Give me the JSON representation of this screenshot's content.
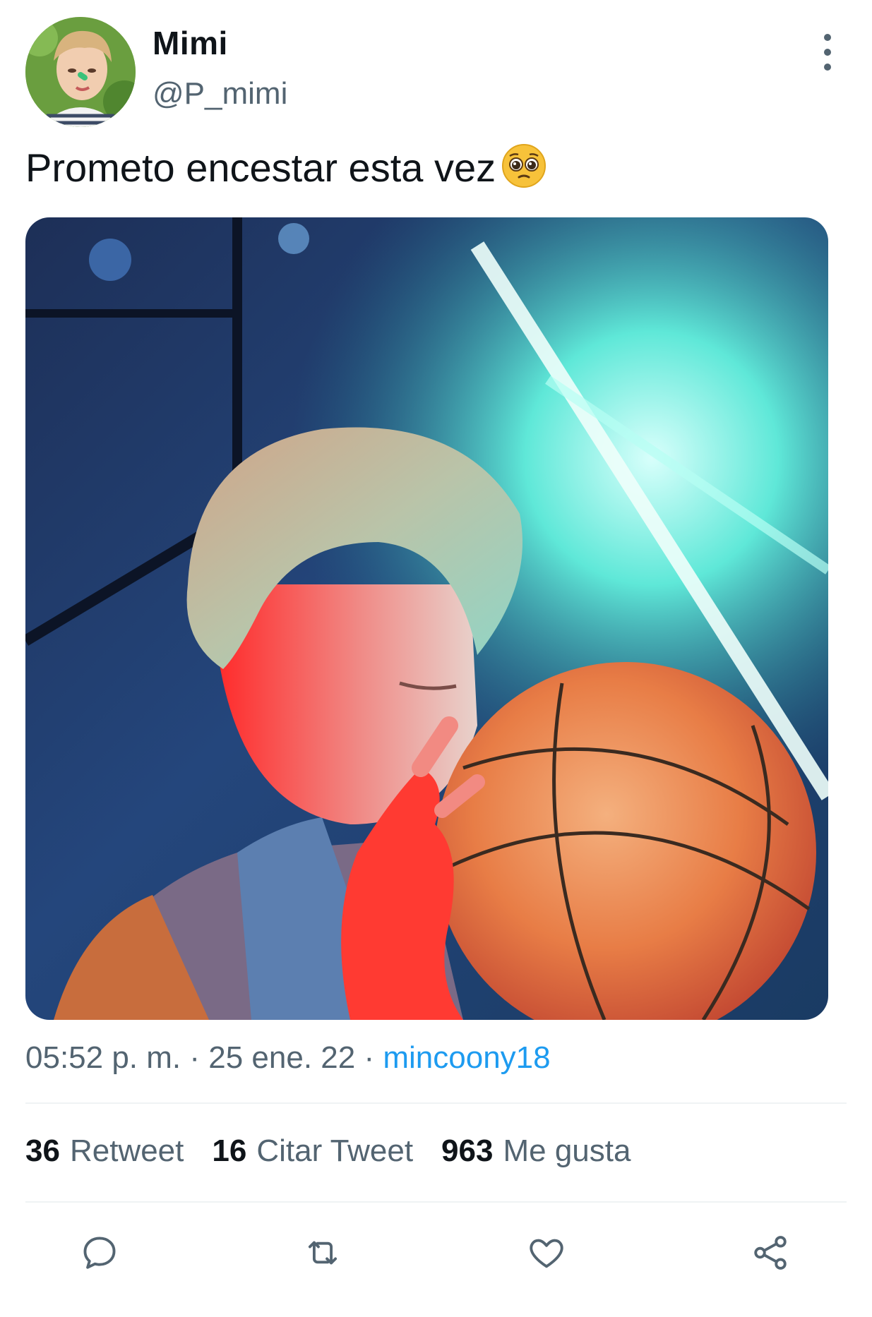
{
  "tweet": {
    "author": {
      "display_name": "Mimi",
      "handle": "@P_mimi"
    },
    "text": "Prometo encestar esta vez",
    "emoji": "pleading-face",
    "media": {
      "kind": "photo",
      "subject": "basketball"
    },
    "meta": {
      "time": "05:52 p. m.",
      "separator": "·",
      "date": "25 ene. 22",
      "source": "mincoony18"
    },
    "stats": {
      "retweets_count": "36",
      "retweets_label": "Retweet",
      "quotes_count": "16",
      "quotes_label": "Citar Tweet",
      "likes_count": "963",
      "likes_label": "Me gusta"
    },
    "actions": {
      "reply": "reply-icon",
      "retweet": "retweet-icon",
      "like": "heart-icon",
      "share": "share-icon"
    }
  },
  "colors": {
    "text_primary": "#0f1419",
    "text_secondary": "#536471",
    "link": "#1d9bf0",
    "divider": "#eff3f4"
  }
}
